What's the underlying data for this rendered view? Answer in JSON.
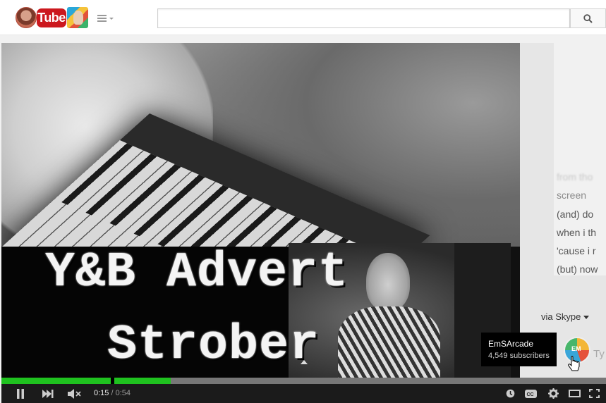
{
  "masthead": {
    "logo_text": "Tube",
    "search": {
      "value": "",
      "placeholder": ""
    }
  },
  "video": {
    "title_line1": "Y&B Advert",
    "title_line2": "Strober",
    "chat_lines": [
      {
        "text": "from tho",
        "style": "blur"
      },
      {
        "text": "screen",
        "style": "normal"
      },
      {
        "text": "(and) do",
        "style": "dark"
      },
      {
        "text": "when i th",
        "style": "dark"
      },
      {
        "text": "'cause i r",
        "style": "dark"
      },
      {
        "text": "(but) now",
        "style": "dark"
      }
    ],
    "via_skype": "via Skype",
    "partial_text": "Ty"
  },
  "channel_card": {
    "name": "EmSArcade",
    "subscribers": "4,549 subscribers"
  },
  "player": {
    "current_time": "0:15",
    "separator": " / ",
    "duration": "0:54",
    "played_fraction": 0.28,
    "loaded_fraction": 1.0,
    "accent_color": "#1fc21f",
    "icons": [
      "pause-icon",
      "next-icon",
      "mute-icon",
      "watch-later-icon",
      "captions-icon",
      "settings-icon",
      "theater-mode-icon",
      "fullscreen-icon"
    ]
  }
}
